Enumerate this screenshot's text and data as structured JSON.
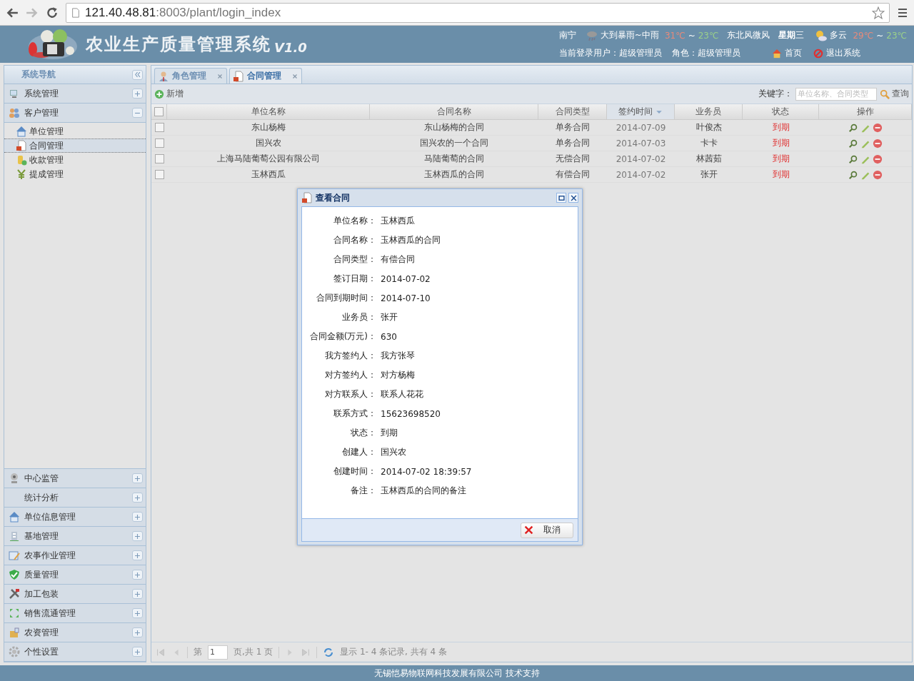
{
  "browser": {
    "url_host": "121.40.48.81",
    "url_path": ":8003/plant/login_index"
  },
  "header": {
    "title": "农业生产质量管理系统",
    "version": "V1.0",
    "weather": {
      "city": "南宁",
      "today": "大到暴雨~中雨",
      "today_high": "31℃",
      "today_sep": "~",
      "today_low": "23℃",
      "wind": "东北风微风",
      "weekday": "**星期**三",
      "tomorrow": "多云",
      "tomorrow_high": "29℃",
      "tomorrow_sep": "~",
      "tomorrow_low": "23℃"
    },
    "user": "当前登录用户：超级管理员",
    "role": "角色：超级管理员",
    "home": "首页",
    "logout": "退出系统"
  },
  "sidebar": {
    "title": "系统导航",
    "groups": [
      {
        "label": "系统管理",
        "expanded": false
      },
      {
        "label": "客户管理",
        "expanded": true,
        "children": [
          {
            "label": "单位管理",
            "selected": false
          },
          {
            "label": "合同管理",
            "selected": true
          },
          {
            "label": "收款管理",
            "selected": false
          },
          {
            "label": "提成管理",
            "selected": false
          }
        ]
      },
      {
        "label": "中心监管",
        "expanded": false
      },
      {
        "label": "统计分析",
        "expanded": false
      },
      {
        "label": "单位信息管理",
        "expanded": false
      },
      {
        "label": "基地管理",
        "expanded": false
      },
      {
        "label": "农事作业管理",
        "expanded": false
      },
      {
        "label": "质量管理",
        "expanded": false
      },
      {
        "label": "加工包装",
        "expanded": false
      },
      {
        "label": "销售流通管理",
        "expanded": false
      },
      {
        "label": "农资管理",
        "expanded": false
      },
      {
        "label": "个性设置",
        "expanded": false
      }
    ]
  },
  "tabs": [
    {
      "label": "角色管理",
      "selected": false
    },
    {
      "label": "合同管理",
      "selected": true
    }
  ],
  "toolbar": {
    "add": "新增",
    "keyword_label": "关键字：",
    "search_placeholder": "单位名称、合同类型",
    "search": "查询"
  },
  "table": {
    "select_all_checked": false,
    "columns": [
      {
        "label": "单位名称",
        "sorted": false
      },
      {
        "label": "合同名称",
        "sorted": false
      },
      {
        "label": "合同类型",
        "sorted": false
      },
      {
        "label": "签约时间",
        "sorted": true
      },
      {
        "label": "业务员",
        "sorted": false
      },
      {
        "label": "状态",
        "sorted": false
      },
      {
        "label": "操作",
        "sorted": false
      }
    ],
    "rows": [
      {
        "checked": false,
        "cells": [
          "东山杨梅",
          "东山杨梅的合同",
          "单务合同",
          "2014-07-09",
          "叶俊杰",
          "到期"
        ]
      },
      {
        "checked": false,
        "cells": [
          "国兴农",
          "国兴农的一个合同",
          "单务合同",
          "2014-07-03",
          "卡卡",
          "到期"
        ]
      },
      {
        "checked": false,
        "cells": [
          "上海马陆葡萄公园有限公司",
          "马陆葡萄的合同",
          "无偿合同",
          "2014-07-02",
          "林茜茹",
          "到期"
        ]
      },
      {
        "checked": false,
        "cells": [
          "玉林西瓜",
          "玉林西瓜的合同",
          "有偿合同",
          "2014-07-02",
          "张开",
          "到期"
        ]
      }
    ]
  },
  "pagination": {
    "page_prefix": "第",
    "page": "1",
    "page_suffix": "页,共 1 页",
    "summary": "显示 1- 4 条记录, 共有 4 条"
  },
  "dialog": {
    "title": "查看合同",
    "fields": [
      {
        "label": "单位名称：",
        "value": "玉林西瓜"
      },
      {
        "label": "合同名称：",
        "value": "玉林西瓜的合同"
      },
      {
        "label": "合同类型：",
        "value": "有偿合同"
      },
      {
        "label": "签订日期：",
        "value": "2014-07-02"
      },
      {
        "label": "合同到期时间：",
        "value": "2014-07-10"
      },
      {
        "label": "业务员：",
        "value": "张开"
      },
      {
        "label": "合同金额(万元)：",
        "value": "630"
      },
      {
        "label": "我方签约人：",
        "value": "我方张琴"
      },
      {
        "label": "对方签约人：",
        "value": "对方杨梅"
      },
      {
        "label": "对方联系人：",
        "value": "联系人花花"
      },
      {
        "label": "联系方式：",
        "value": "15623698520"
      },
      {
        "label": "状态：",
        "value": "到期"
      },
      {
        "label": "创建人：",
        "value": "国兴农"
      },
      {
        "label": "创建时间：",
        "value": "2014-07-02 18:39:57"
      },
      {
        "label": "备注：",
        "value": "玉林西瓜的合同的备注"
      }
    ],
    "cancel": "取消"
  },
  "footer": "无锡恺易物联网科技发展有限公司 技术支持"
}
